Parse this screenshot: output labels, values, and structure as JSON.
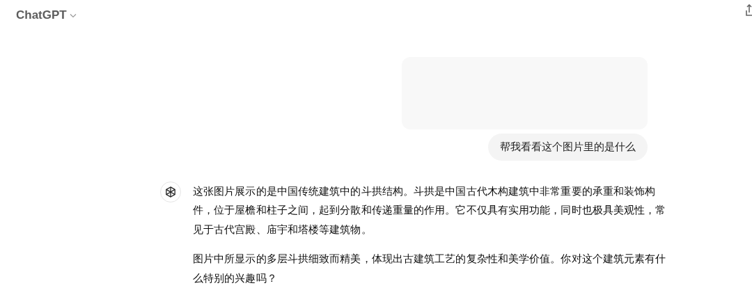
{
  "header": {
    "title": "ChatGPT"
  },
  "messages": [
    {
      "kind": "user_image"
    },
    {
      "kind": "user_text",
      "text": "帮我看看这个图片里的是什么"
    },
    {
      "kind": "assistant_text",
      "paragraphs": [
        "这张图片展示的是中国传统建筑中的斗拱结构。斗拱是中国古代木构建筑中非常重要的承重和装饰构件，位于屋檐和柱子之间，起到分散和传递重量的作用。它不仅具有实用功能，同时也极具美观性，常见于古代宫殿、庙宇和塔楼等建筑物。",
        "图片中所显示的多层斗拱细致而精美，体现出古建筑工艺的复杂性和美学价值。你对这个建筑元素有什么特别的兴趣吗？"
      ]
    }
  ]
}
